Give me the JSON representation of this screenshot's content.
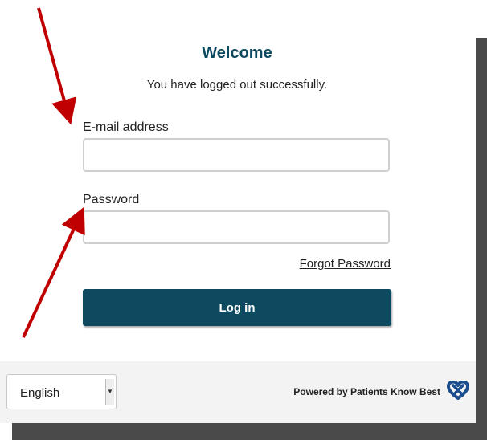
{
  "header": {
    "title": "Welcome",
    "message": "You have logged out successfully."
  },
  "form": {
    "email_label": "E-mail address",
    "email_value": "",
    "password_label": "Password",
    "password_value": "",
    "forgot_label": "Forgot Password",
    "login_label": "Log in"
  },
  "footer": {
    "language_selected": "English",
    "powered_by": "Powered by Patients Know Best",
    "logo_icon": "pkb-logo-icon"
  },
  "colors": {
    "brand": "#0e4a5f",
    "arrow": "#c00000",
    "logo": "#1c4d8c"
  }
}
